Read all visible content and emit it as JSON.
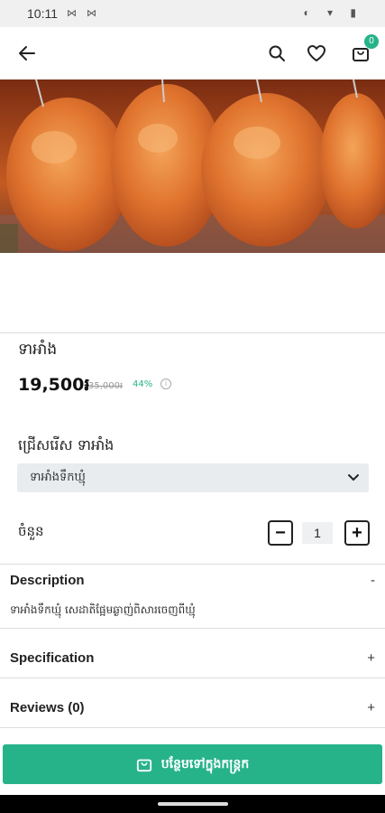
{
  "status_bar": {
    "time": "10:11",
    "notifications": "⋈ ⋈",
    "system": "◐ ▾ ▮"
  },
  "header": {
    "back_icon": "arrow-left-icon",
    "search_icon": "search-icon",
    "wishlist_icon": "heart-icon",
    "cart_icon": "shopping-bag-icon",
    "cart_count": "0"
  },
  "product": {
    "name": "ទាអាំង",
    "price": "19,500៛",
    "original_price": "35,000៛",
    "discount": "44%",
    "info_icon": "info-icon"
  },
  "variant": {
    "label": "ជ្រើសរើស ទាអាំង",
    "selected": "ទាអាំងទឹកឃ្មុំ"
  },
  "quantity": {
    "label": "ចំនួន",
    "minus": "−",
    "value": "1",
    "plus": "+"
  },
  "sections": {
    "description": {
      "title": "Description",
      "sign": "-",
      "text": "ទាអាំងទឹកឃ្មុំ សេដាតិផ្អែមឆ្ងាញ់ពិសារចេញពីឃ្មុំ"
    },
    "specification": {
      "title": "Specification",
      "sign": "+"
    },
    "reviews": {
      "title": "Reviews (0)",
      "sign": "+"
    }
  },
  "cta": {
    "label": "បន្ថែមទៅក្នុងកន្ត្រក",
    "icon": "shopping-bag-icon"
  },
  "colors": {
    "accent": "#26b38a"
  }
}
